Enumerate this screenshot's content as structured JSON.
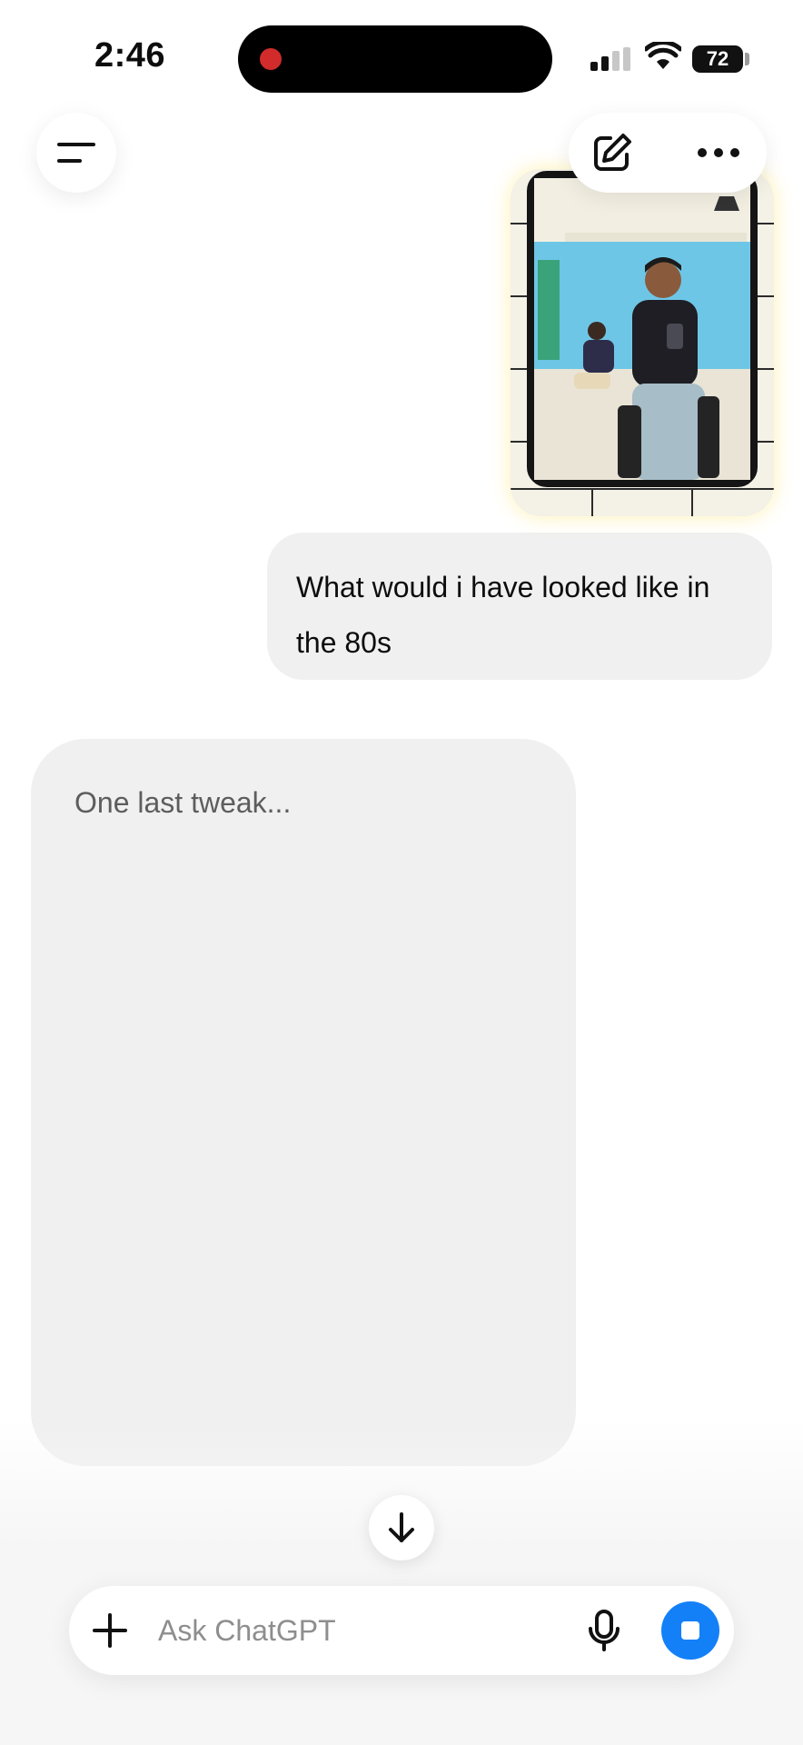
{
  "status_bar": {
    "time": "2:46",
    "battery": "72"
  },
  "header": {
    "menu_icon": "menu-icon",
    "compose_icon": "compose-icon",
    "more_icon": "more-dots-icon"
  },
  "conversation": {
    "user_image_alt": "",
    "user_message": "What would i have looked like in the 80s",
    "assistant_status": "One last tweak..."
  },
  "composer": {
    "placeholder": "Ask ChatGPT",
    "value": ""
  },
  "colors": {
    "accent": "#1480f8",
    "bubble": "#f0f0f0",
    "recording_dot": "#d12b2b"
  }
}
